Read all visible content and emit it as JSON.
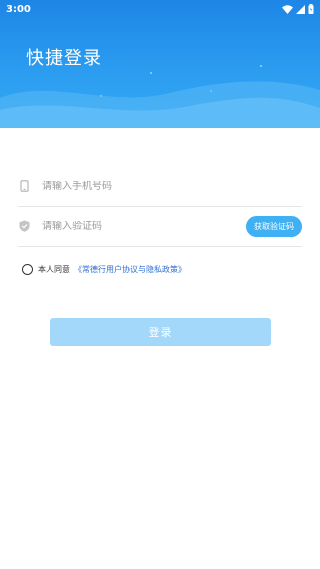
{
  "status_bar": {
    "time": "3:00",
    "icons": [
      "wifi-icon",
      "signal-icon",
      "battery-icon"
    ]
  },
  "header": {
    "title": "快捷登录"
  },
  "phone_field": {
    "placeholder": "请输入手机号码",
    "icon": "phone-icon"
  },
  "code_field": {
    "placeholder": "请输入验证码",
    "icon": "shield-icon",
    "button_label": "获取验证码"
  },
  "agreement": {
    "prefix": "本人同意",
    "link": "《常德行用户协议与隐私政策》",
    "checked": false
  },
  "login_button": {
    "label": "登录"
  },
  "colors": {
    "primary": "#2b9cf0",
    "button_disabled": "#a3d8fa",
    "link": "#2f6fd6"
  }
}
